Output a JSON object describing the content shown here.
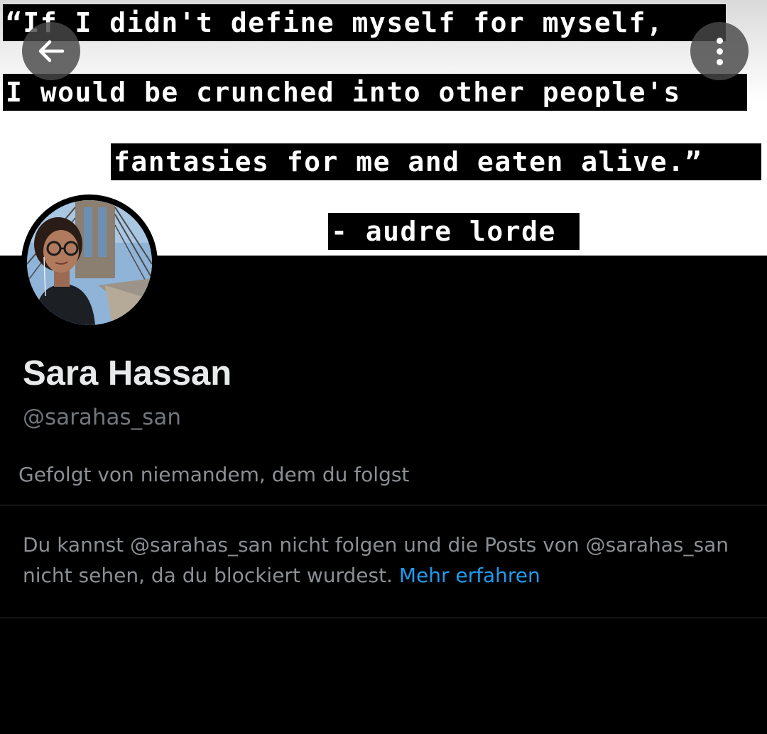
{
  "banner": {
    "quote_lines": [
      "“If I didn't define myself for myself,",
      "I would be crunched into other people's",
      "fantasies for me and eaten alive.”",
      "- audre lorde"
    ]
  },
  "nav": {
    "back_icon": "arrow-left-icon",
    "more_icon": "more-vertical-icon"
  },
  "profile": {
    "display_name": "Sara Hassan",
    "handle": "@sarahas_san",
    "followed_by": "Gefolgt von niemandem, dem du folgst",
    "blocked_text": "Du kannst @sarahas_san nicht folgen und die Posts von @sarahas_san nicht sehen, da du blockiert wurdest. ",
    "learn_more": "Mehr erfahren"
  },
  "colors": {
    "background": "#000000",
    "primary_text": "#e7e9ea",
    "secondary_text": "#71767b",
    "link": "#1d9bf0",
    "divider": "#2f3336"
  }
}
